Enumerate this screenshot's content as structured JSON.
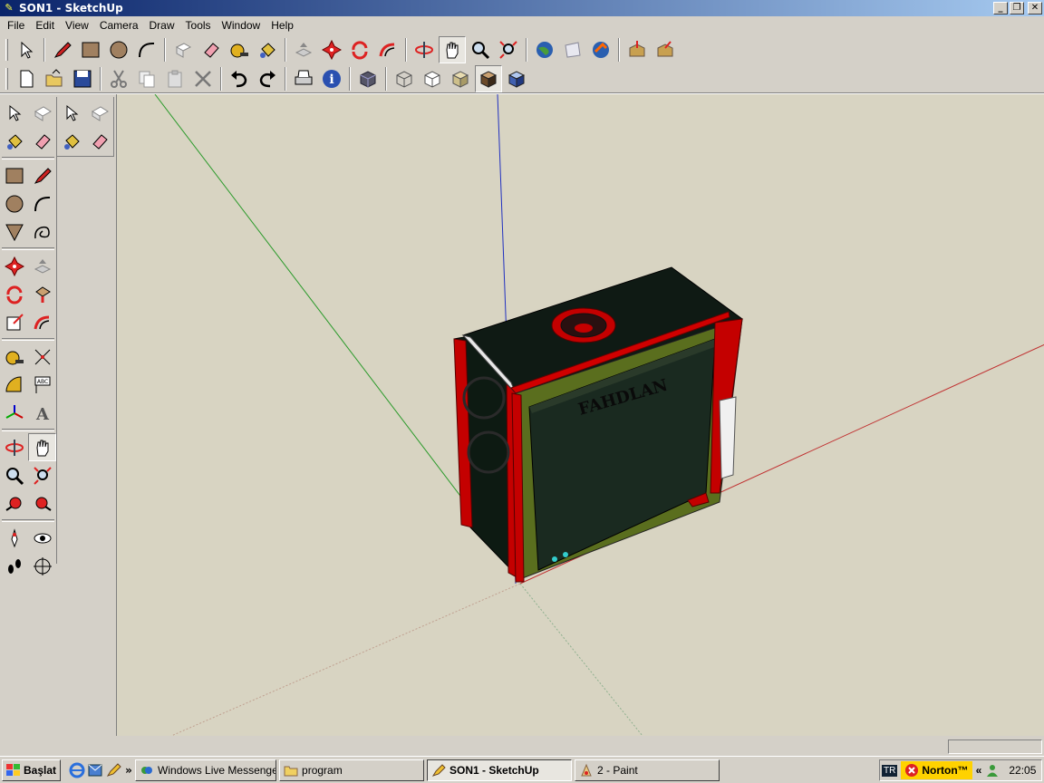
{
  "window": {
    "title": "SON1 - SketchUp",
    "minimize": "_",
    "restore": "❐",
    "close": "✕"
  },
  "menu": [
    "File",
    "Edit",
    "View",
    "Camera",
    "Draw",
    "Tools",
    "Window",
    "Help"
  ],
  "toolbar1": [
    "select-icon",
    "pencil-icon",
    "rectangle-icon",
    "circle-icon",
    "arc-icon",
    "make-component-icon",
    "eraser-icon",
    "tape-measure-icon",
    "paint-bucket-icon",
    "push-pull-icon",
    "move-icon",
    "rotate-icon",
    "follow-me-icon",
    "orbit-icon",
    "pan-icon",
    "zoom-icon",
    "zoom-extents-icon",
    "get-models-icon",
    "share-model-icon",
    "google-earth-icon",
    "import-icon",
    "export-icon"
  ],
  "toolbar2": [
    "new-icon",
    "open-icon",
    "save-icon",
    "cut-icon",
    "copy-icon",
    "paste-icon",
    "delete-icon",
    "undo-icon",
    "redo-icon",
    "print-icon",
    "model-info-icon",
    "iso-view-icon",
    "xray-icon",
    "wireframe-icon",
    "hidden-line-icon",
    "shaded-icon",
    "textured-icon"
  ],
  "model": {
    "label": "FAHDLAN"
  },
  "taskbar": {
    "start": "Başlat",
    "more": "»",
    "tasks": [
      {
        "label": "Windows Live Messenger"
      },
      {
        "label": "program"
      },
      {
        "label": "SON1 - SketchUp"
      },
      {
        "label": "2 - Paint"
      }
    ],
    "tray": {
      "lang": "TR",
      "norton": "Norton™",
      "chevron": "«",
      "time": "22:05"
    }
  },
  "colors": {
    "case_red": "#c40000",
    "case_green": "#5a6e1e",
    "case_dark": "#0f1a14",
    "sky": "#d8d4c2"
  }
}
